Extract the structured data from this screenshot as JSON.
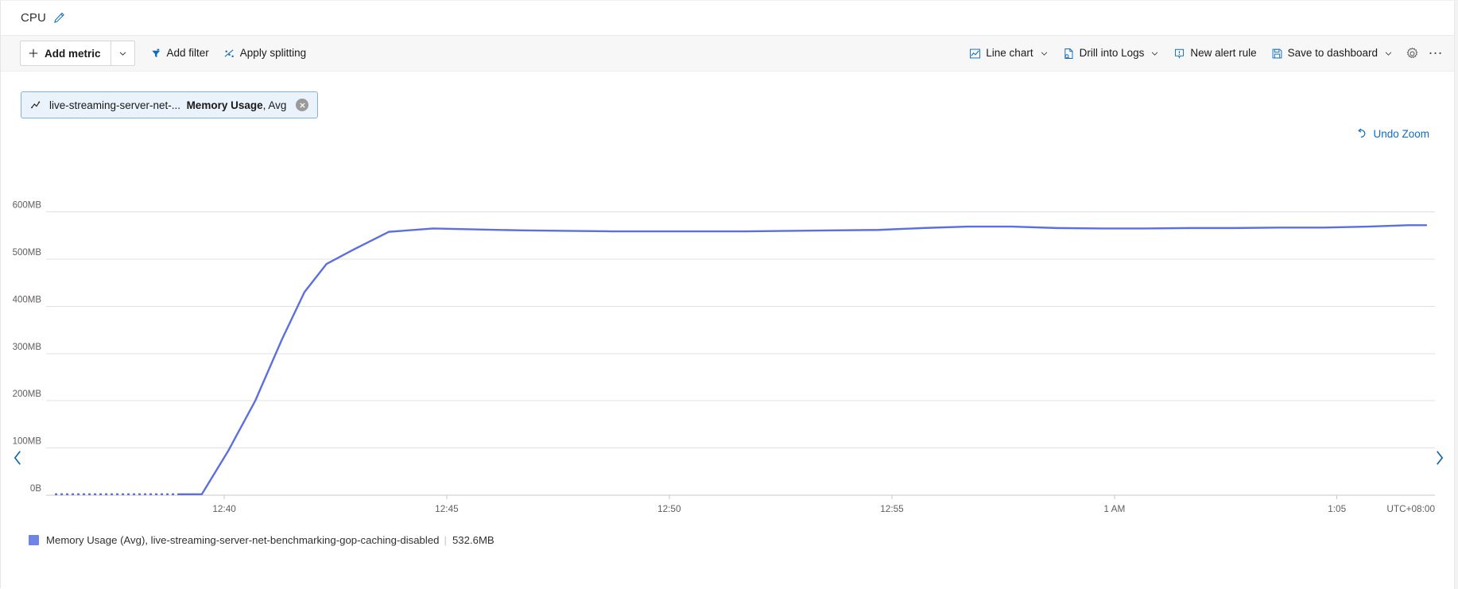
{
  "header": {
    "title": "CPU",
    "edit_icon": "pencil-icon"
  },
  "toolbar": {
    "add_metric_label": "Add metric",
    "add_metric_icon": "plus-icon",
    "add_metric_caret_icon": "chevron-down-icon",
    "add_filter_label": "Add filter",
    "add_filter_icon": "filter-icon",
    "apply_splitting_label": "Apply splitting",
    "apply_splitting_icon": "splitting-icon",
    "line_chart_label": "Line chart",
    "line_chart_icon": "line-chart-icon",
    "line_chart_caret_icon": "chevron-down-icon",
    "drill_into_logs_label": "Drill into Logs",
    "drill_into_logs_icon": "logs-icon",
    "drill_into_logs_caret_icon": "chevron-down-icon",
    "new_alert_rule_label": "New alert rule",
    "new_alert_rule_icon": "alert-bell-icon",
    "save_to_dashboard_label": "Save to dashboard",
    "save_to_dashboard_icon": "save-disk-icon",
    "save_to_dashboard_caret_icon": "chevron-down-icon",
    "settings_icon": "gear-icon",
    "more_label": "…",
    "more_icon": "ellipsis-icon"
  },
  "metric_chip": {
    "scope_icon": "metric-sparkline-icon",
    "resource": "live-streaming-server-net-...",
    "metric": "Memory Usage",
    "aggregation": ", Avg",
    "close_icon": "close-circle-icon"
  },
  "chart_controls": {
    "undo_zoom_label": "Undo Zoom",
    "undo_zoom_icon": "undo-arrow-icon",
    "prev_icon": "chevron-left-icon",
    "next_icon": "chevron-right-icon"
  },
  "legend": {
    "swatch_color": "#7084e8",
    "series_label": "Memory Usage (Avg), live-streaming-server-net-benchmarking-gop-caching-disabled",
    "separator": "|",
    "value": "532.6MB"
  },
  "chart_data": {
    "type": "line",
    "title": "",
    "xlabel": "",
    "ylabel": "",
    "timezone_label": "UTC+08:00",
    "grid": true,
    "legend_position": "bottom-left",
    "line_color": "#5c6fe0",
    "ylim": [
      0,
      650
    ],
    "y_ticks": [
      0,
      100,
      200,
      300,
      400,
      500,
      600
    ],
    "y_tick_labels": [
      "0B",
      "100MB",
      "200MB",
      "300MB",
      "400MB",
      "500MB",
      "600MB"
    ],
    "x_ticks": [
      12.6667,
      12.75,
      12.8333,
      12.9167,
      13.0,
      13.0833
    ],
    "x_tick_labels": [
      "12:40",
      "12:45",
      "12:50",
      "12:55",
      "1 AM",
      "1:05"
    ],
    "xlim": [
      12.6,
      13.12
    ],
    "series": [
      {
        "name": "Memory Usage (Avg), live-streaming-server-net-benchmarking-gop-caching-disabled",
        "current_value": "532.6MB",
        "leading_dashed_segment": true,
        "x": [
          12.6033,
          12.61,
          12.6167,
          12.6233,
          12.63,
          12.6367,
          12.6433,
          12.65,
          12.6583,
          12.6683,
          12.6783,
          12.6883,
          12.6967,
          12.705,
          12.715,
          12.7283,
          12.745,
          12.7617,
          12.7783,
          12.795,
          12.8117,
          12.8283,
          12.845,
          12.8617,
          12.8783,
          12.895,
          12.9117,
          12.9283,
          12.945,
          12.9617,
          12.9783,
          12.995,
          13.0117,
          13.0283,
          13.045,
          13.0617,
          13.0783,
          13.095,
          13.11,
          13.1167
        ],
        "values": [
          2,
          2,
          2,
          2,
          2,
          2,
          2,
          2,
          2,
          95,
          200,
          330,
          430,
          490,
          520,
          558,
          565,
          563,
          561,
          560,
          559,
          559,
          559,
          559,
          560,
          561,
          562,
          566,
          569,
          569,
          566,
          565,
          565,
          566,
          566,
          567,
          567,
          569,
          572,
          572
        ]
      }
    ]
  }
}
